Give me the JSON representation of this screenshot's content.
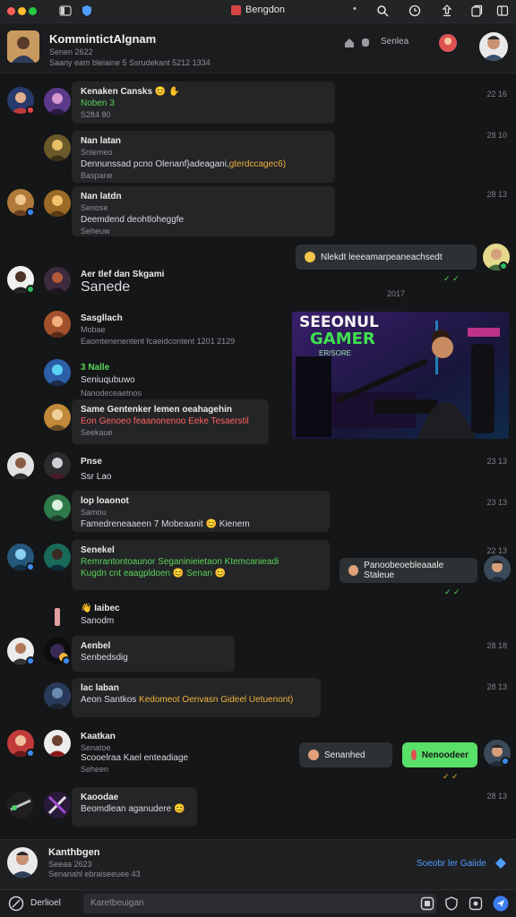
{
  "window": {
    "title": "Bengdon"
  },
  "header": {
    "title": "KommintictAlgnam",
    "sub1": "Senen 2622",
    "sub2": "Saany eam bleiaine 5 Ssrudekant 5212 1334",
    "action_label": "Senlea"
  },
  "messages": [
    {
      "name": "Kenaken Cansks 😊 ✋",
      "line2": "Noben 3",
      "line3": "S2ft4 80",
      "time": "22 16"
    },
    {
      "name": "Nan latan",
      "line2": "Snlemeo",
      "line3": "Dennunssad pcno Olenanf}adeagani,",
      "line3_accent": "gterdccagec6)",
      "line4": "Baspane",
      "time": "28 10"
    },
    {
      "name": "Nan latdn",
      "line2": "Senose",
      "line3": "Deemdend deohtloheggfe",
      "line4": "Seheuw",
      "time": "28 13"
    },
    {
      "name": "Aer tlef dan Skgami",
      "line2": "Sanede"
    },
    {
      "name": "Sasgllach",
      "line2": "Mobae",
      "line3": "Eaomtenenentent fcaeidcontent 1201 2129"
    },
    {
      "name": "3 Nalle",
      "line2": "Seniuqubuwo",
      "line3": "Nanodeceaetnos"
    },
    {
      "name": "Same Gentenker lemen oeahagehin",
      "line2": "Eon Genoeo feaanonenoo Eeke Tesaerstil",
      "line3": "Seekaue"
    },
    {
      "name": "Pnse",
      "line2": "Ssr Lao",
      "time": "23 13"
    },
    {
      "name": "lop loaonot",
      "line2": "Samou",
      "line3": "Famedreneaaeen 7 Mobeaanit 😊 Kienem",
      "time": "23 13"
    },
    {
      "name": "Senekel",
      "line2": "Remrantontoaunor Seganinieietaon Ktemcanieadi",
      "line3": "Kugdn cnt eaagpldoen 😊 Senan 😊",
      "time": "22 13"
    },
    {
      "name": "👋 Iaibec",
      "line2": "Sanodm"
    },
    {
      "name": "Aenbel",
      "line2": "Senbedsdig",
      "time": "28 18"
    },
    {
      "name": "lac laban",
      "line2": "Aeon Santkos",
      "line2_accent": "Kedomeot Oenvasn Gideel Uetuenont)",
      "time": "28 13"
    },
    {
      "name": "Kaatkan",
      "line2": "Senatoe",
      "line3": "Scooelraa Kael enteadiage",
      "line4": "Seheen"
    },
    {
      "name": "Kaoodae",
      "line2": "Beomdlean aganudere 😊",
      "time": "28 13"
    }
  ],
  "outgoing": [
    {
      "text": "Nlekdt leeeamarpeaneachsedt",
      "ticks": "✓ ✓"
    },
    {
      "text": "Panoobeoebleaaale Staleue"
    },
    {
      "text": "Senanhed"
    },
    {
      "text": "Nenoodeer"
    }
  ],
  "date_separator": "2017",
  "shared_image": {
    "line1": "SEEONUL",
    "line2": "GAMER",
    "line3": "ER/SORE"
  },
  "bottom_card": {
    "title": "Kanthbgen",
    "sub1": "Seeaa 2623",
    "sub2": "Senanahl ebraiseeuee 43",
    "link": "Soeobr ler Gaiide"
  },
  "composer": {
    "label": "Derlioel",
    "placeholder": "Karetbeuigan"
  },
  "colors": {
    "background": "#151617",
    "bubble": "#242527",
    "accent_green": "#58e068",
    "link_blue": "#4f9dff"
  }
}
